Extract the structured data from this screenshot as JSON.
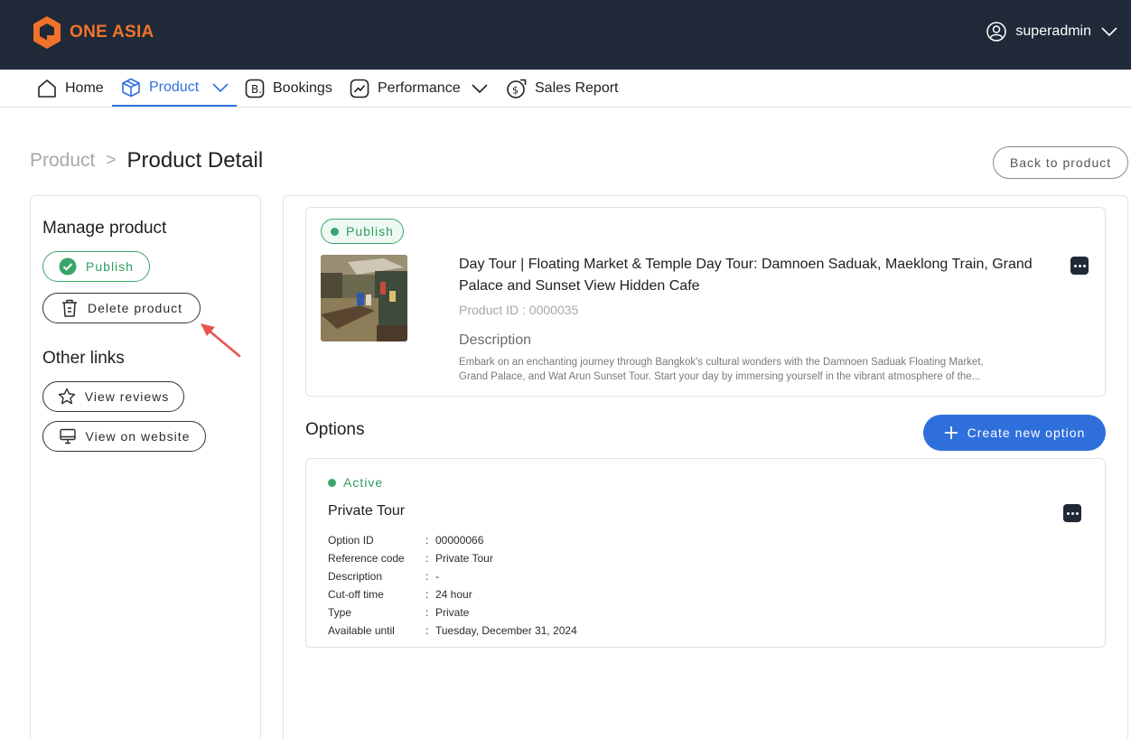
{
  "brand": {
    "name": "ONE ASIA",
    "color": "#f2722b"
  },
  "user": {
    "name": "superadmin"
  },
  "nav": {
    "items": [
      {
        "label": "Home",
        "icon": "home-icon"
      },
      {
        "label": "Product",
        "icon": "box-icon",
        "active": true,
        "dropdown": true
      },
      {
        "label": "Bookings",
        "icon": "bookings-icon"
      },
      {
        "label": "Performance",
        "icon": "chart-icon",
        "dropdown": true
      },
      {
        "label": "Sales Report",
        "icon": "money-icon"
      }
    ]
  },
  "breadcrumb": {
    "parent": "Product",
    "separator": ">",
    "current": "Product Detail"
  },
  "back_button": "Back to product",
  "manage": {
    "title": "Manage product",
    "publish_label": "Publish",
    "delete_label": "Delete product"
  },
  "other_links": {
    "title": "Other links",
    "reviews_label": "View reviews",
    "website_label": "View on website"
  },
  "product": {
    "status": "Publish",
    "title": "Day Tour | Floating Market & Temple Day Tour: Damnoen Saduak, Maeklong Train, Grand Palace and Sunset View Hidden Cafe",
    "id_text": "Product ID : 0000035",
    "description_label": "Description",
    "description_line1": "Embark on an enchanting journey through Bangkok's cultural wonders with the Damnoen Saduak Floating Market,",
    "description_line2": "Grand Palace, and Wat Arun Sunset Tour. Start your day by immersing yourself in the vibrant atmosphere of the..."
  },
  "options": {
    "title": "Options",
    "create_label": "Create new option",
    "items": [
      {
        "status": "Active",
        "name": "Private Tour",
        "fields": [
          {
            "key": "Option ID",
            "value": "00000066"
          },
          {
            "key": "Reference code",
            "value": "Private Tour"
          },
          {
            "key": "Description",
            "value": "-"
          },
          {
            "key": "Cut-off time",
            "value": "24 hour"
          },
          {
            "key": "Type",
            "value": "Private"
          },
          {
            "key": "Available until",
            "value": "Tuesday, December 31, 2024"
          }
        ]
      }
    ]
  },
  "colors": {
    "primary": "#2f6fdc",
    "success": "#3aa56b",
    "header_bg": "#1f2937",
    "annotation": "#e8554e"
  }
}
